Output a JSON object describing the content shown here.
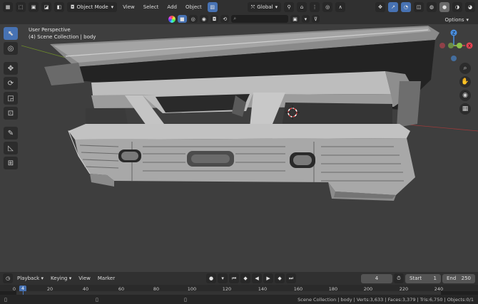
{
  "header": {
    "mode_label": "Object Mode",
    "menus": [
      "View",
      "Select",
      "Add",
      "Object"
    ],
    "orientation_label": "Global",
    "options_label": "Options"
  },
  "viewport": {
    "view_name": "User Perspective",
    "collection_info": "(4) Scene Collection | body"
  },
  "gizmo": {
    "z_label": "Z",
    "x_label": "X"
  },
  "timeline": {
    "menus": [
      "Playback",
      "Keying",
      "View",
      "Marker"
    ],
    "current_frame": "4",
    "start_label": "Start",
    "start_value": "1",
    "end_label": "End",
    "end_value": "250",
    "ruler": [
      "0",
      "20",
      "40",
      "60",
      "80",
      "100",
      "120",
      "140",
      "160",
      "180",
      "200",
      "220",
      "240"
    ]
  },
  "statusbar": {
    "text": "Scene Collection | body | Verts:3,633 | Faces:3,379 | Tris:6,750 | Objects:0/1"
  },
  "colors": {
    "accent": "#4772b3",
    "axis_x": "#e04452",
    "axis_y": "#8bc34a",
    "axis_z": "#4a8fe0"
  }
}
